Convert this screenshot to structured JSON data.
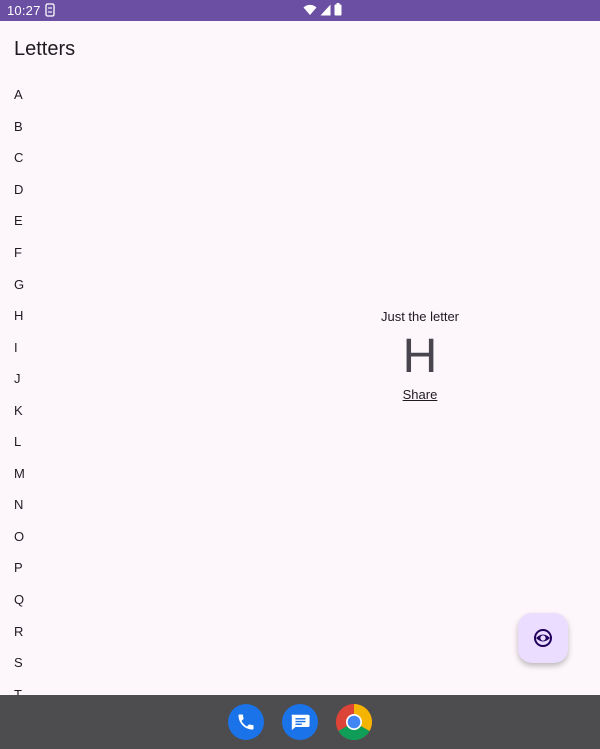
{
  "status_bar": {
    "time": "10:27",
    "background_color": "#6b4fa3",
    "icons": [
      "sim-icon",
      "wifi-icon",
      "signal-icon",
      "battery-icon"
    ]
  },
  "page": {
    "title": "Letters"
  },
  "letters": [
    "A",
    "B",
    "C",
    "D",
    "E",
    "F",
    "G",
    "H",
    "I",
    "J",
    "K",
    "L",
    "M",
    "N",
    "O",
    "P",
    "Q",
    "R",
    "S",
    "T"
  ],
  "detail": {
    "caption": "Just the letter",
    "letter": "H",
    "share_label": "Share"
  },
  "fab": {
    "icon": "eye-icon",
    "background_color": "#eaddff"
  },
  "dock": {
    "apps": [
      "phone-icon",
      "messages-icon",
      "chrome-icon"
    ],
    "background_color": "#4d4c4f"
  }
}
